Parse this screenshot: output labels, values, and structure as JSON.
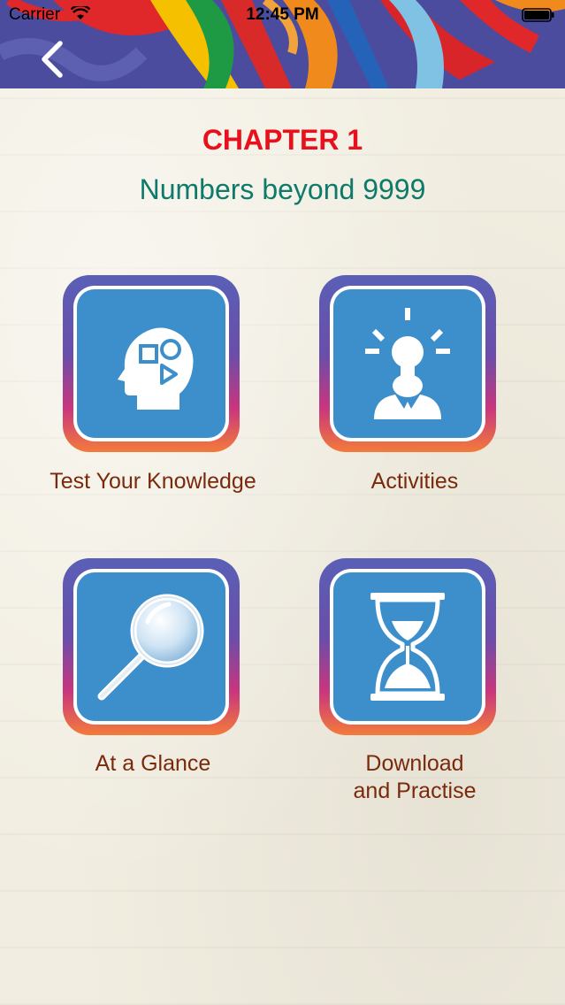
{
  "status_bar": {
    "carrier": "Carrier",
    "time": "12:45 PM"
  },
  "header": {
    "back_icon": "chevron-left-icon"
  },
  "chapter": {
    "title": "CHAPTER 1",
    "subtitle": "Numbers beyond 9999"
  },
  "menu": [
    {
      "label": "Test Your Knowledge",
      "icon": "head-shapes-icon"
    },
    {
      "label": "Activities",
      "icon": "lightbulb-person-icon"
    },
    {
      "label": "At a Glance",
      "icon": "magnifier-icon"
    },
    {
      "label_line1": "Download",
      "label_line2": "and Practise",
      "icon": "hourglass-icon"
    }
  ],
  "colors": {
    "chapter_title": "#e8101c",
    "chapter_subtitle": "#0d7a6a",
    "label": "#7a2a0c",
    "tile_face": "#3d8fcc"
  }
}
